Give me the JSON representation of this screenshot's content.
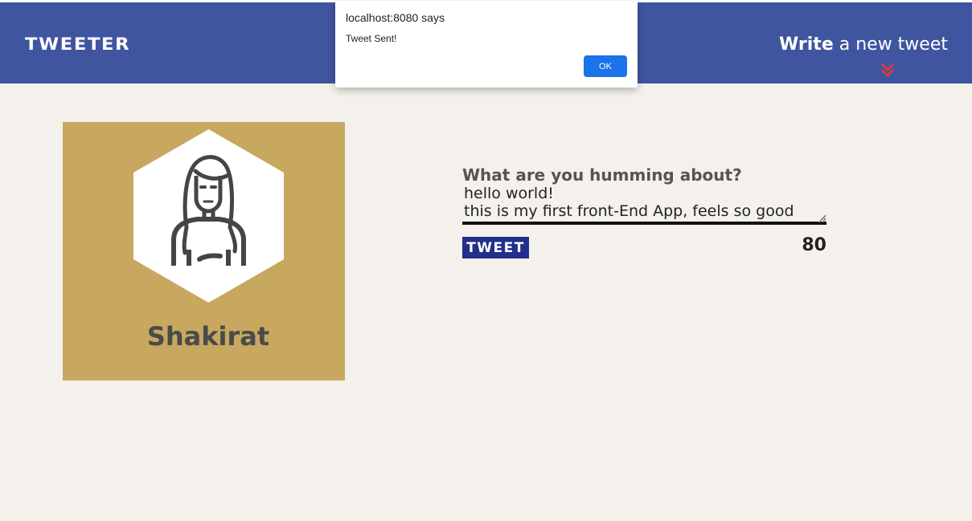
{
  "app": {
    "brand": "TWEETER",
    "compose_toggle": {
      "strong": "Write",
      "rest": " a new tweet",
      "icon": "double-chevron-down-icon"
    }
  },
  "profile": {
    "name": "Shakirat",
    "avatar_icon": "user-avatar-icon"
  },
  "tweet_form": {
    "prompt": "What are you humming about?",
    "text": "hello world!\nthis is my first front-End App, feels so good",
    "button_label": "TWEET",
    "char_counter": "80"
  },
  "alert": {
    "title": "localhost:8080 says",
    "message": "Tweet Sent!",
    "ok_label": "OK"
  },
  "colors": {
    "nav_background": "#4055a0",
    "page_background": "#f4f1ec",
    "profile_card": "#c8a75f",
    "tweet_button": "#232f8c",
    "chevron": "#d93a3a",
    "alert_ok": "#1a73e8"
  }
}
